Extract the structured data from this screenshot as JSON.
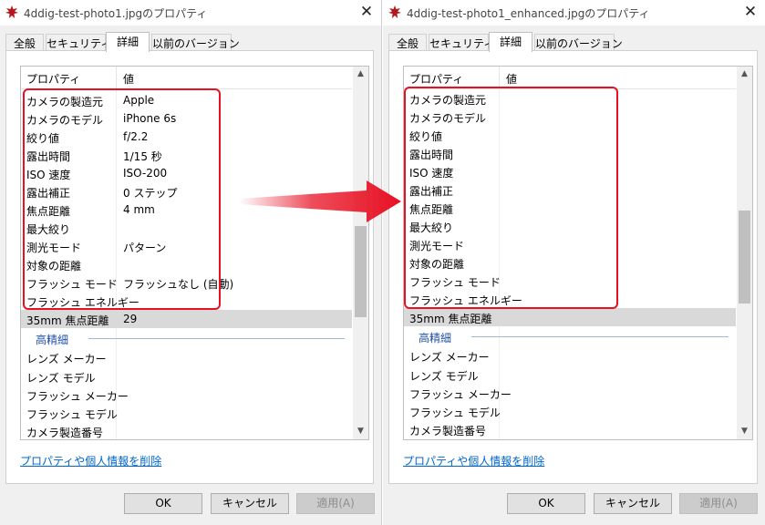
{
  "dialogs": [
    {
      "title": "4ddig-test-photo1.jpgのプロパティ",
      "tabs": [
        "全般",
        "セキュリティ",
        "詳細",
        "以前のバージョン"
      ],
      "active_tab": 2,
      "columns": {
        "property": "プロパティ",
        "value": "値"
      },
      "rows": [
        {
          "name": "カメラの製造元",
          "value": "Apple"
        },
        {
          "name": "カメラのモデル",
          "value": "iPhone 6s"
        },
        {
          "name": "絞り値",
          "value": "f/2.2"
        },
        {
          "name": "露出時間",
          "value": "1/15 秒"
        },
        {
          "name": "ISO 速度",
          "value": "ISO-200"
        },
        {
          "name": "露出補正",
          "value": "0 ステップ"
        },
        {
          "name": "焦点距離",
          "value": "4 mm"
        },
        {
          "name": "最大絞り",
          "value": ""
        },
        {
          "name": "測光モード",
          "value": "パターン"
        },
        {
          "name": "対象の距離",
          "value": ""
        },
        {
          "name": "フラッシュ モード",
          "value": "フラッシュなし (自動)"
        },
        {
          "name": "フラッシュ エネルギー",
          "value": ""
        },
        {
          "name": "35mm 焦点距離",
          "value": "29"
        }
      ],
      "selected_row": 12,
      "group_label": "高精細",
      "advanced_rows": [
        {
          "name": "レンズ メーカー",
          "value": ""
        },
        {
          "name": "レンズ モデル",
          "value": ""
        },
        {
          "name": "フラッシュ メーカー",
          "value": ""
        },
        {
          "name": "フラッシュ モデル",
          "value": ""
        },
        {
          "name": "カメラ製造番号",
          "value": ""
        }
      ],
      "remove_link": "プロパティや個人情報を削除",
      "buttons": {
        "ok": "OK",
        "cancel": "キャンセル",
        "apply": "適用(A)"
      }
    },
    {
      "title": "4ddig-test-photo1_enhanced.jpgのプロパティ",
      "tabs": [
        "全般",
        "セキュリティ",
        "詳細",
        "以前のバージョン"
      ],
      "active_tab": 2,
      "columns": {
        "property": "プロパティ",
        "value": "値"
      },
      "rows": [
        {
          "name": "カメラの製造元",
          "value": ""
        },
        {
          "name": "カメラのモデル",
          "value": ""
        },
        {
          "name": "絞り値",
          "value": ""
        },
        {
          "name": "露出時間",
          "value": ""
        },
        {
          "name": "ISO 速度",
          "value": ""
        },
        {
          "name": "露出補正",
          "value": ""
        },
        {
          "name": "焦点距離",
          "value": ""
        },
        {
          "name": "最大絞り",
          "value": ""
        },
        {
          "name": "測光モード",
          "value": ""
        },
        {
          "name": "対象の距離",
          "value": ""
        },
        {
          "name": "フラッシュ モード",
          "value": ""
        },
        {
          "name": "フラッシュ エネルギー",
          "value": ""
        },
        {
          "name": "35mm 焦点距離",
          "value": ""
        }
      ],
      "selected_row": 12,
      "group_label": "高精細",
      "advanced_rows": [
        {
          "name": "レンズ メーカー",
          "value": ""
        },
        {
          "name": "レンズ モデル",
          "value": ""
        },
        {
          "name": "フラッシュ メーカー",
          "value": ""
        },
        {
          "name": "フラッシュ モデル",
          "value": ""
        },
        {
          "name": "カメラ製造番号",
          "value": ""
        }
      ],
      "remove_link": "プロパティや個人情報を削除",
      "buttons": {
        "ok": "OK",
        "cancel": "キャンセル",
        "apply": "適用(A)"
      }
    }
  ],
  "icons": {
    "app_icon": "red-photo-maple-icon",
    "close": "close-icon",
    "scroll_up": "chevron-up-icon",
    "scroll_down": "chevron-down-icon",
    "arrow": "red-arrow-right"
  },
  "colors": {
    "highlight": "#e81123",
    "arrow": "#e81123",
    "link": "#0066cc",
    "selected_row": "#d9d9d9",
    "group_label": "#1f4fa3"
  }
}
